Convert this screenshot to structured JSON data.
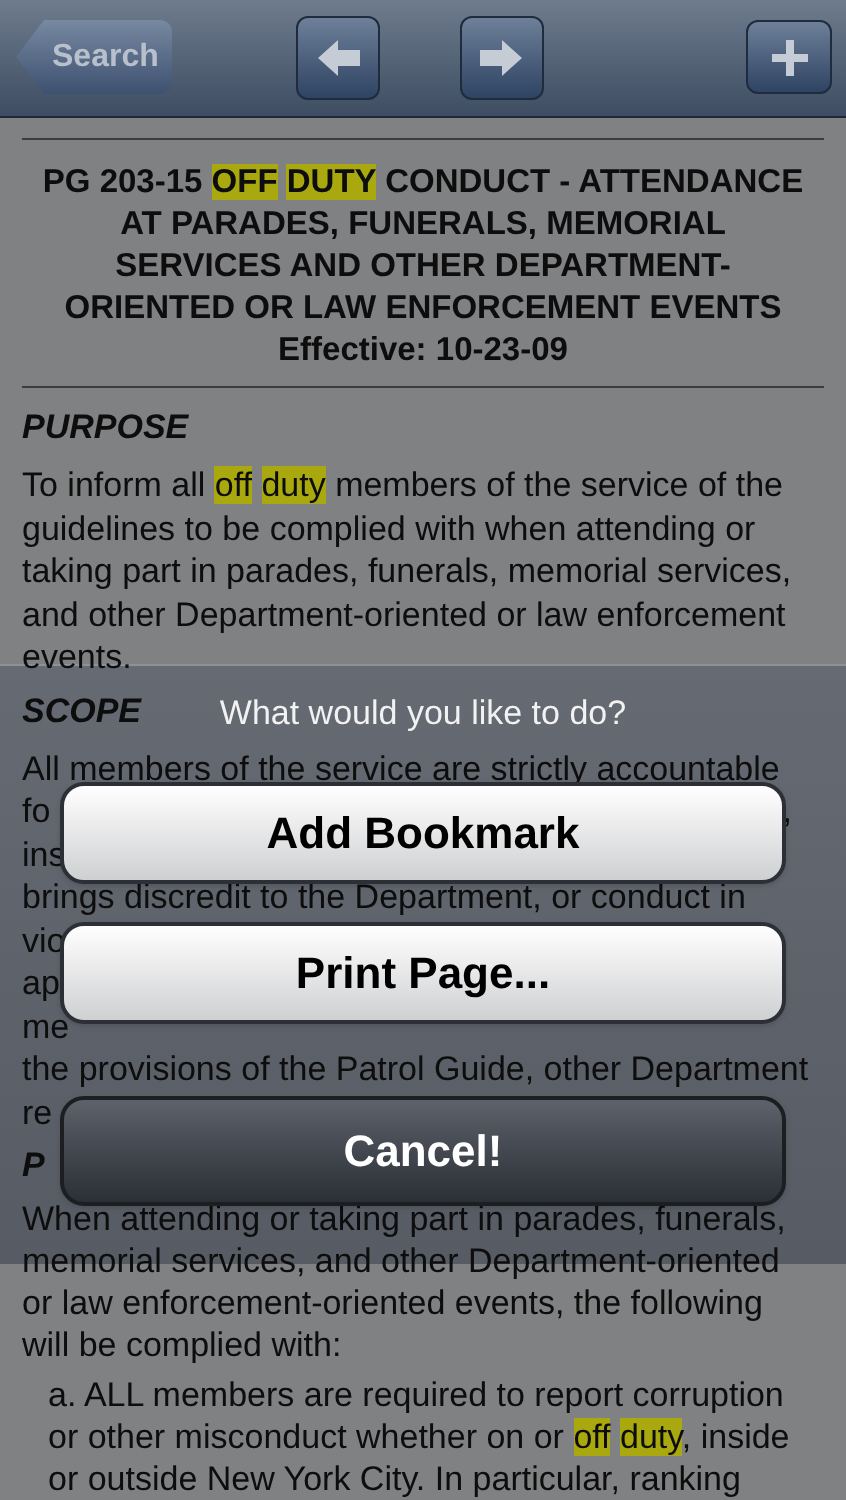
{
  "nav_bar": {
    "back_button": "Search",
    "buttons": [
      {
        "kind": "back"
      },
      {
        "kind": "forward"
      },
      {
        "kind": "add"
      }
    ]
  },
  "document": {
    "title_lines": [
      [
        {
          "text": "PG 203-15 "
        },
        {
          "text": "OFF DUTY",
          "highlight": true
        },
        {
          "text": " CONDUCT - ATTENDANCE"
        }
      ],
      [
        {
          "text": "AT PARADES, FUNERALS, MEMORIAL"
        }
      ],
      [
        {
          "text": "SERVICES AND OTHER DEPARTMENT-"
        }
      ],
      [
        {
          "text": "ORIENTED OR LAW ENFORCEMENT EVENTS"
        }
      ],
      [
        {
          "text": "Effective: 10-23-09"
        }
      ]
    ],
    "blocks": [
      {
        "kind": "heading",
        "text": "PURPOSE"
      },
      {
        "kind": "line",
        "segments": [
          {
            "text": "To inform all "
          },
          {
            "text": "off duty",
            "highlight": true
          },
          {
            "text": " members of the service of the"
          }
        ]
      },
      {
        "kind": "line",
        "segments": [
          {
            "text": "guidelines to be complied with when attending or"
          }
        ]
      },
      {
        "kind": "line",
        "segments": [
          {
            "text": "taking part in parades, funerals, memorial services,"
          }
        ]
      },
      {
        "kind": "line",
        "segments": [
          {
            "text": "and other Department-oriented or law enforcement"
          }
        ]
      },
      {
        "kind": "line",
        "segments": [
          {
            "text": "events."
          }
        ]
      },
      {
        "kind": "heading",
        "text": "SCOPE"
      },
      {
        "kind": "line",
        "segments": [
          {
            "text": "All members of the service are strictly accountable"
          }
        ]
      },
      {
        "kind": "line",
        "segments": [
          {
            "text": "fo"
          }
        ],
        "end": ","
      },
      {
        "kind": "line",
        "segments": [
          {
            "text": "ins"
          }
        ]
      },
      {
        "kind": "line",
        "segments": [
          {
            "text": "brings discredit to the Department, or conduct in"
          }
        ]
      },
      {
        "kind": "line",
        "segments": [
          {
            "text": "vio"
          }
        ]
      },
      {
        "kind": "line",
        "segments": [
          {
            "text": "ap"
          }
        ]
      },
      {
        "kind": "line",
        "segments": [
          {
            "text": "me"
          }
        ]
      },
      {
        "kind": "line",
        "segments": [
          {
            "text": "the provisions of the Patrol Guide, other Department"
          }
        ]
      },
      {
        "kind": "line",
        "segments": [
          {
            "text": "re"
          }
        ]
      },
      {
        "kind": "heading",
        "text": "P"
      },
      {
        "kind": "line",
        "segments": [
          {
            "text": "When attending or taking part in parades, funerals,"
          }
        ]
      },
      {
        "kind": "line",
        "segments": [
          {
            "text": "memorial services, and other Department-oriented"
          }
        ]
      },
      {
        "kind": "line",
        "segments": [
          {
            "text": "or law enforcement-oriented events, the following"
          }
        ]
      },
      {
        "kind": "line",
        "segments": [
          {
            "text": "will be complied with:"
          }
        ]
      },
      {
        "kind": "item",
        "segments": [
          {
            "text": "a. ALL members are required to report corruption"
          }
        ]
      },
      {
        "kind": "item",
        "segments": [
          {
            "text": "or other misconduct whether on or "
          },
          {
            "text": "off duty",
            "highlight": true
          },
          {
            "text": ", inside"
          }
        ]
      },
      {
        "kind": "item",
        "segments": [
          {
            "text": "or outside New York City. In particular, ranking"
          }
        ]
      }
    ]
  },
  "action_sheet": {
    "title": "What would you like to do?",
    "buttons": [
      {
        "label": "Add Bookmark",
        "kind": "default"
      },
      {
        "label": "Print Page...",
        "kind": "default"
      },
      {
        "label": "Cancel!",
        "kind": "cancel"
      }
    ]
  }
}
